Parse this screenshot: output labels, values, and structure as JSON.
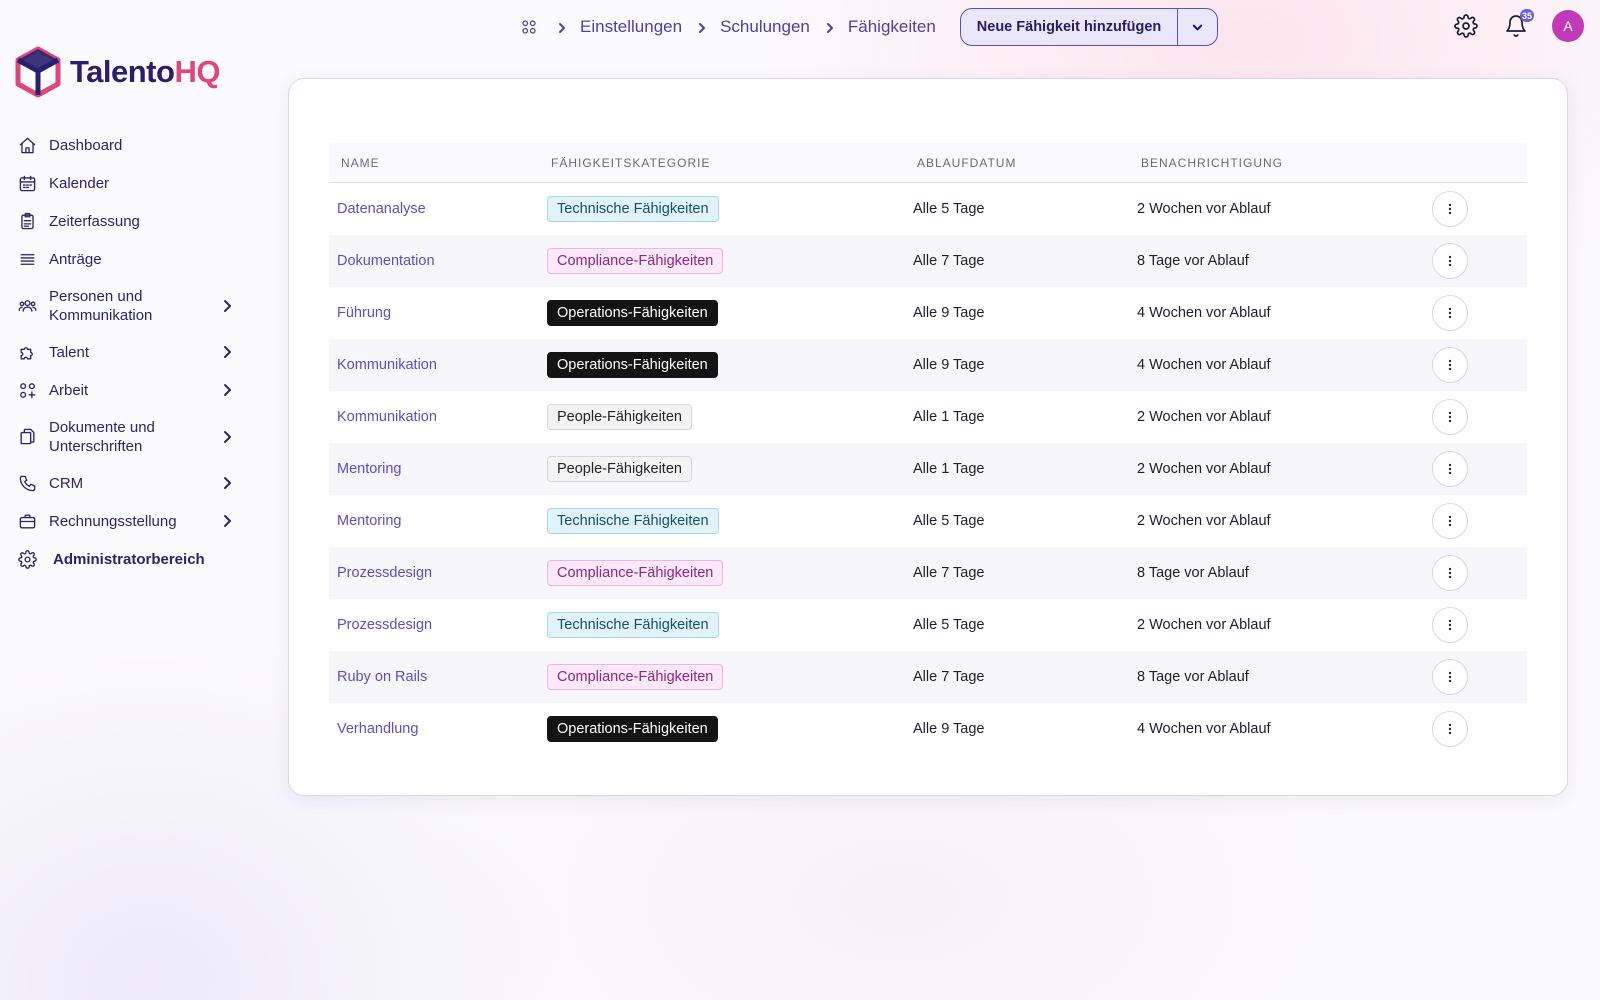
{
  "brand": {
    "name_part1": "Talento",
    "name_part2": "HQ",
    "colors": {
      "primary": "#2a1f6e",
      "accent": "#e0457b"
    }
  },
  "sidebar": {
    "items": [
      {
        "label": "Dashboard",
        "icon": "home-icon"
      },
      {
        "label": "Kalender",
        "icon": "calendar-icon"
      },
      {
        "label": "Zeiterfassung",
        "icon": "clipboard-icon"
      },
      {
        "label": "Anträge",
        "icon": "list-icon"
      },
      {
        "label": "Personen und Kommunikation",
        "icon": "people-icon",
        "expandable": true
      },
      {
        "label": "Talent",
        "icon": "puzzle-icon",
        "expandable": true
      },
      {
        "label": "Arbeit",
        "icon": "apps-icon",
        "expandable": true
      },
      {
        "label": "Dokumente und Unterschriften",
        "icon": "documents-icon",
        "expandable": true
      },
      {
        "label": "CRM",
        "icon": "phone-icon",
        "expandable": true
      },
      {
        "label": "Rechnungsstellung",
        "icon": "briefcase-icon",
        "expandable": true
      },
      {
        "label": "Administratorbereich",
        "icon": "gear-icon"
      }
    ]
  },
  "breadcrumb": {
    "items": [
      "Einstellungen",
      "Schulungen",
      "Fähigkeiten"
    ]
  },
  "header": {
    "primary_action": "Neue Fähigkeit hinzufügen",
    "notification_count": "35",
    "avatar_initial": "A"
  },
  "table": {
    "headers": [
      "Name",
      "Fähigkeitskategorie",
      "Ablaufdatum",
      "Benachrichtigung"
    ],
    "rows": [
      {
        "name": "Datenanalyse",
        "category": "Technische Fähigkeiten",
        "category_type": "tech",
        "expiry": "Alle 5 Tage",
        "notification": "2 Wochen vor Ablauf"
      },
      {
        "name": "Dokumentation",
        "category": "Compliance-Fähigkeiten",
        "category_type": "comp",
        "expiry": "Alle 7 Tage",
        "notification": "8 Tage vor Ablauf"
      },
      {
        "name": "Führung",
        "category": "Operations-Fähigkeiten",
        "category_type": "ops",
        "expiry": "Alle 9 Tage",
        "notification": "4 Wochen vor Ablauf"
      },
      {
        "name": "Kommunikation",
        "category": "Operations-Fähigkeiten",
        "category_type": "ops",
        "expiry": "Alle 9 Tage",
        "notification": "4 Wochen vor Ablauf"
      },
      {
        "name": "Kommunikation",
        "category": "People-Fähigkeiten",
        "category_type": "people",
        "expiry": "Alle 1 Tage",
        "notification": "2 Wochen vor Ablauf"
      },
      {
        "name": "Mentoring",
        "category": "People-Fähigkeiten",
        "category_type": "people",
        "expiry": "Alle 1 Tage",
        "notification": "2 Wochen vor Ablauf"
      },
      {
        "name": "Mentoring",
        "category": "Technische Fähigkeiten",
        "category_type": "tech",
        "expiry": "Alle 5 Tage",
        "notification": "2 Wochen vor Ablauf"
      },
      {
        "name": "Prozessdesign",
        "category": "Compliance-Fähigkeiten",
        "category_type": "comp",
        "expiry": "Alle 7 Tage",
        "notification": "8 Tage vor Ablauf"
      },
      {
        "name": "Prozessdesign",
        "category": "Technische Fähigkeiten",
        "category_type": "tech",
        "expiry": "Alle 5 Tage",
        "notification": "2 Wochen vor Ablauf"
      },
      {
        "name": "Ruby on Rails",
        "category": "Compliance-Fähigkeiten",
        "category_type": "comp",
        "expiry": "Alle 7 Tage",
        "notification": "8 Tage vor Ablauf"
      },
      {
        "name": "Verhandlung",
        "category": "Operations-Fähigkeiten",
        "category_type": "ops",
        "expiry": "Alle 9 Tage",
        "notification": "4 Wochen vor Ablauf"
      }
    ]
  }
}
